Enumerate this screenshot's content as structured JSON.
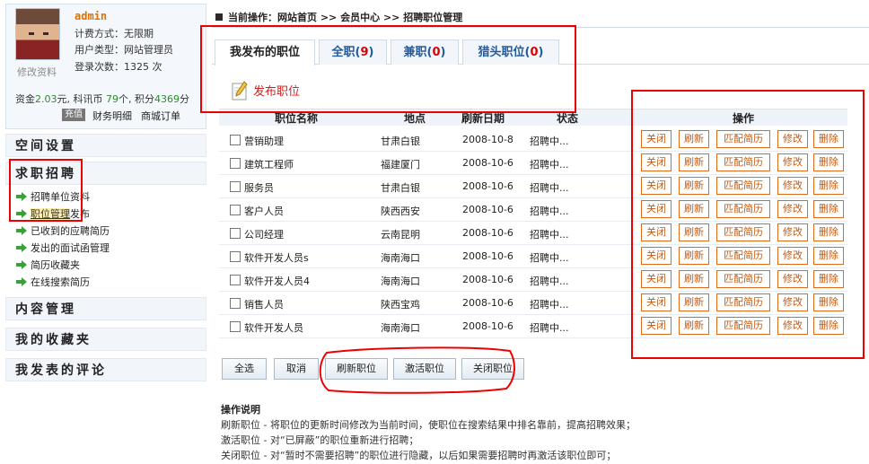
{
  "user": {
    "name": "admin",
    "edit_profile": "修改资料",
    "billing": "计费方式：无限期",
    "user_type": "用户类型：网站管理员",
    "login_count": "登录次数：1325 次",
    "funds_prefix": "资金",
    "funds_amount": "2.03",
    "funds_mid": "元, 科讯币",
    "coins": "79",
    "coins_mid": "个, 积分",
    "points": "4369",
    "points_suffix": "分",
    "recharge": "充值",
    "finance": "财务明细",
    "mall_orders": "商城订单"
  },
  "sidebar": {
    "space_settings": "空间设置",
    "job_section": "求职招聘",
    "items": [
      {
        "label": "招聘单位资料"
      },
      {
        "label": "职位管理",
        "suffix": "发布"
      },
      {
        "label": "已收到的应聘简历"
      },
      {
        "label": "发出的面试函管理"
      },
      {
        "label": "简历收藏夹"
      },
      {
        "label": "在线搜索简历"
      }
    ],
    "content_mgmt": "内容管理",
    "favorites": "我的收藏夹",
    "my_comments": "我发表的评论"
  },
  "breadcrumb": {
    "label": "当前操作：",
    "path": "网站首页 >> 会员中心 >> 招聘职位管理",
    "p1": "网站首页",
    "p2": "会员中心",
    "p3": "招聘职位管理",
    "sep": ">>"
  },
  "tabs": [
    {
      "label": "我发布的职位"
    },
    {
      "label": "全职",
      "count": "9"
    },
    {
      "label": "兼职",
      "count": "0"
    },
    {
      "label": "猎头职位",
      "count": "0"
    }
  ],
  "post_job": "发布职位",
  "table": {
    "headers": [
      "职位名称",
      "地点",
      "刷新日期",
      "状态",
      "操作"
    ],
    "rows": [
      {
        "title": "营销助理",
        "location": "甘肃白银",
        "date": "2008-10-8",
        "status": "招聘中..."
      },
      {
        "title": "建筑工程师",
        "location": "福建厦门",
        "date": "2008-10-6",
        "status": "招聘中..."
      },
      {
        "title": "服务员",
        "location": "甘肃白银",
        "date": "2008-10-6",
        "status": "招聘中..."
      },
      {
        "title": "客户人员",
        "location": "陕西西安",
        "date": "2008-10-6",
        "status": "招聘中..."
      },
      {
        "title": "公司经理",
        "location": "云南昆明",
        "date": "2008-10-6",
        "status": "招聘中..."
      },
      {
        "title": "软件开发人员s",
        "location": "海南海口",
        "date": "2008-10-6",
        "status": "招聘中..."
      },
      {
        "title": "软件开发人员4",
        "location": "海南海口",
        "date": "2008-10-6",
        "status": "招聘中..."
      },
      {
        "title": "销售人员",
        "location": "陕西宝鸡",
        "date": "2008-10-6",
        "status": "招聘中..."
      },
      {
        "title": "软件开发人员",
        "location": "海南海口",
        "date": "2008-10-6",
        "status": "招聘中..."
      }
    ],
    "ops": [
      "关闭",
      "刷新",
      "匹配简历",
      "修改",
      "删除"
    ]
  },
  "buttons": {
    "select_all": "全选",
    "cancel": "取消",
    "refresh": "刷新职位",
    "activate": "激活职位",
    "close": "关闭职位"
  },
  "notes": {
    "title": "操作说明",
    "lines": [
      "刷新职位 - 将职位的更新时间修改为当前时间，使职位在搜索结果中排名靠前，提高招聘效果；",
      "激活职位 - 对“已屏蔽”的职位重新进行招聘；",
      "关闭职位 - 对“暂时不需要招聘”的职位进行隐藏，以后如果需要招聘时再激活该职位即可；"
    ]
  },
  "colors": {
    "accent_orange": "#e06a1a",
    "count_red": "#dd0000",
    "annotation_red": "#ee0000",
    "link_blue": "#235a9a"
  }
}
